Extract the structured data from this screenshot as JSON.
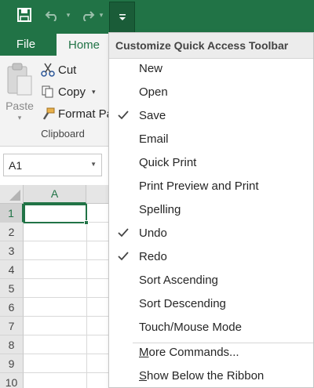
{
  "ribbon": {
    "tabs": [
      "File",
      "Home"
    ],
    "clipboard": {
      "paste": "Paste",
      "cut": "Cut",
      "copy": "Copy",
      "format_painter": "Format Pa",
      "group_label": "Clipboard"
    }
  },
  "namebox": {
    "value": "A1"
  },
  "grid": {
    "column": "A",
    "rows": [
      "1",
      "2",
      "3",
      "4",
      "5",
      "6",
      "7",
      "8",
      "9",
      "10"
    ]
  },
  "qat_menu": {
    "title": "Customize Quick Access Toolbar",
    "items": [
      {
        "label": "New",
        "checked": false
      },
      {
        "label": "Open",
        "checked": false
      },
      {
        "label": "Save",
        "checked": true
      },
      {
        "label": "Email",
        "checked": false
      },
      {
        "label": "Quick Print",
        "checked": false
      },
      {
        "label": "Print Preview and Print",
        "checked": false
      },
      {
        "label": "Spelling",
        "checked": false
      },
      {
        "label": "Undo",
        "checked": true
      },
      {
        "label": "Redo",
        "checked": true
      },
      {
        "label": "Sort Ascending",
        "checked": false
      },
      {
        "label": "Sort Descending",
        "checked": false
      },
      {
        "label": "Touch/Mouse Mode",
        "checked": false
      }
    ],
    "more_commands": {
      "accel": "M",
      "rest": "ore Commands..."
    },
    "show_below": {
      "accel": "S",
      "rest": "how Below the Ribbon"
    }
  },
  "colors": {
    "accent": "#217346",
    "menu_header_bg": "#ececec",
    "ribbon_bg": "#f3f3f3"
  }
}
